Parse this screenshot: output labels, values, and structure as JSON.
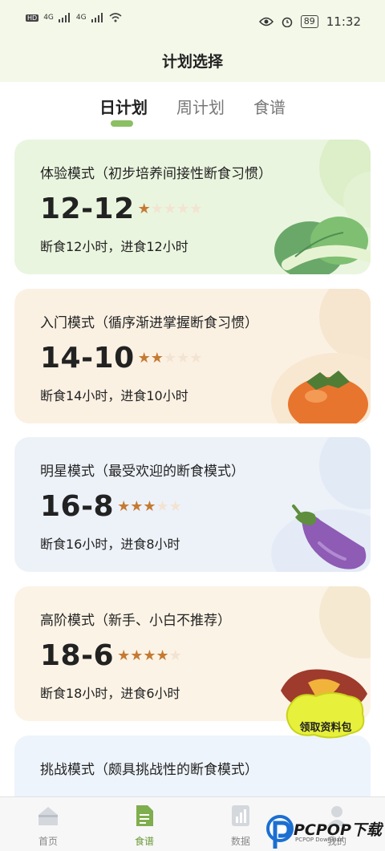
{
  "status_bar": {
    "left_badges": [
      "HD",
      "HD"
    ],
    "signal_labels": [
      "4G",
      "4G"
    ],
    "battery": "89",
    "time": "11:32"
  },
  "header": {
    "title": "计划选择"
  },
  "tabs": [
    {
      "label": "日计划",
      "active": true
    },
    {
      "label": "周计划",
      "active": false
    },
    {
      "label": "食谱",
      "active": false
    }
  ],
  "plans": [
    {
      "subtitle": "体验模式（初步培养间接性断食习惯）",
      "mode": "12-12",
      "rating": 1,
      "max_rating": 5,
      "desc": "断食12小时，进食12小时",
      "image": "bok-choy-icon"
    },
    {
      "subtitle": "入门模式（循序渐进掌握断食习惯）",
      "mode": "14-10",
      "rating": 2,
      "max_rating": 5,
      "desc": "断食14小时，进食10小时",
      "image": "persimmon-icon"
    },
    {
      "subtitle": "明星模式（最受欢迎的断食模式）",
      "mode": "16-8",
      "rating": 3,
      "max_rating": 5,
      "desc": "断食16小时，进食8小时",
      "image": "eggplant-icon"
    },
    {
      "subtitle": "高阶模式（新手、小白不推荐）",
      "mode": "18-6",
      "rating": 4,
      "max_rating": 5,
      "desc": "断食18小时，进食6小时",
      "image": "sweet-potato-icon"
    },
    {
      "subtitle": "挑战模式（颇具挑战性的断食模式）"
    }
  ],
  "promo_badge": {
    "label": "领取资料包"
  },
  "bottom_nav": [
    {
      "label": "首页",
      "icon": "home-icon",
      "active": false
    },
    {
      "label": "食谱",
      "icon": "document-icon",
      "active": true
    },
    {
      "label": "数据",
      "icon": "chart-icon",
      "active": false
    },
    {
      "label": "我的",
      "icon": "profile-icon",
      "active": false
    }
  ],
  "watermark": {
    "brand": "PCPOP下载",
    "sub": "PCPOP Download"
  },
  "colors": {
    "accent_green": "#8bbf64",
    "star_on": "#c57a33",
    "star_off": "#f2e3d2",
    "nav_active": "#6b9a3c"
  }
}
